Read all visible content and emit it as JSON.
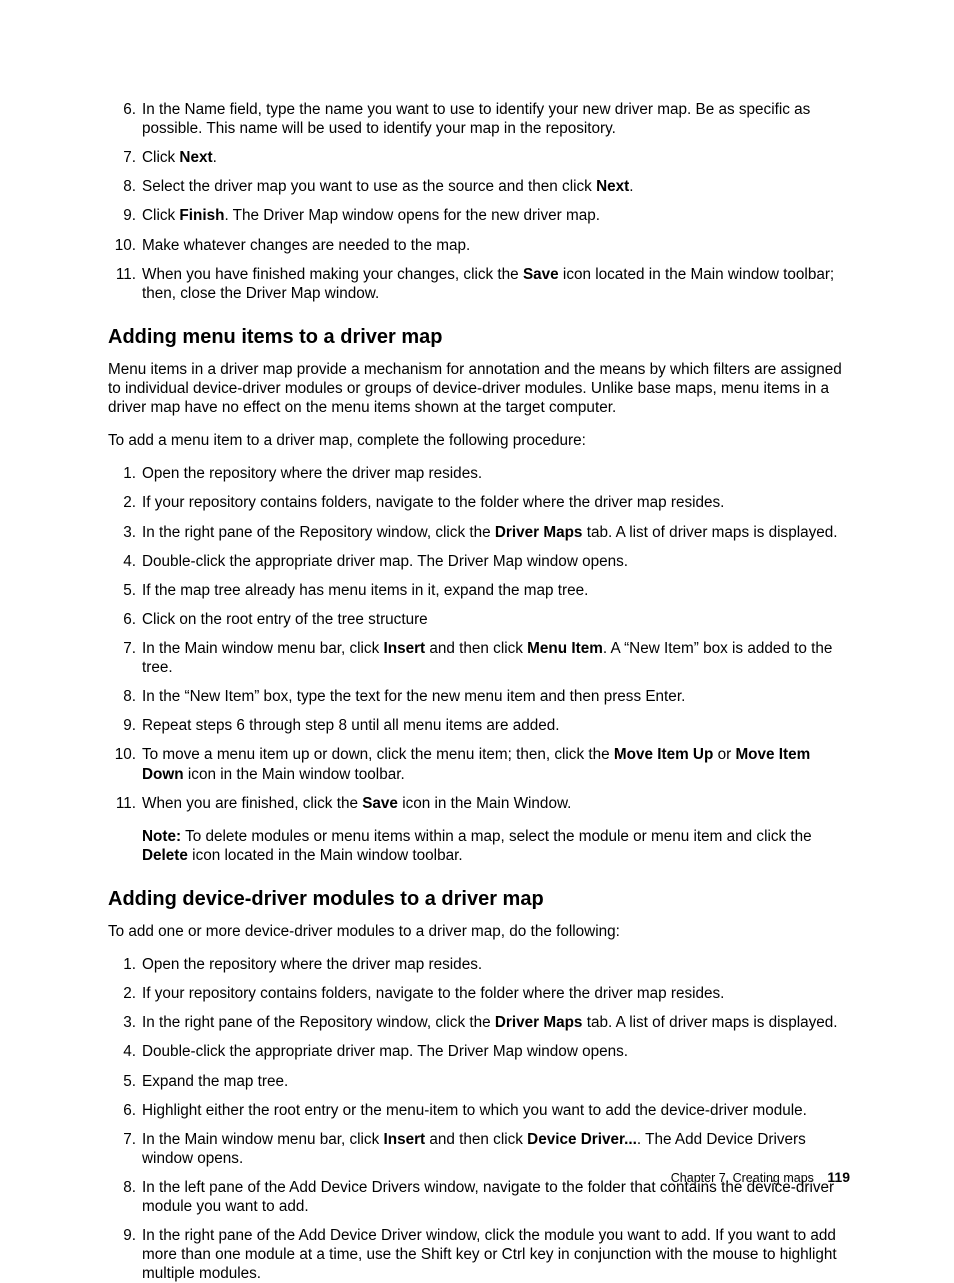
{
  "list1": [
    {
      "n": "6.",
      "html": "In the Name field, type the name you want to use to identify your new driver map. Be as specific as possible. This name will be used to identify your map in the repository."
    },
    {
      "n": "7.",
      "html": "Click <b>Next</b>."
    },
    {
      "n": "8.",
      "html": "Select the driver map you want to use as the source and then click <b>Next</b>."
    },
    {
      "n": "9.",
      "html": "Click <b>Finish</b>. The Driver Map window opens for the new driver map."
    },
    {
      "n": "10.",
      "html": "Make whatever changes are needed to the map."
    },
    {
      "n": "11.",
      "html": "When you have finished making your changes, click the <b>Save</b> icon located in the Main window toolbar; then, close the Driver Map window."
    }
  ],
  "sectionA": {
    "title": "Adding menu items to a driver map",
    "intro": "Menu items in a driver map provide a mechanism for annotation and the means by which filters are assigned to individual device-driver modules or groups of device-driver modules. Unlike base maps, menu items in a driver map have no effect on the menu items shown at the target computer.",
    "lead": "To add a menu item to a driver map, complete the following procedure:",
    "items": [
      {
        "n": "1.",
        "html": "Open the repository where the driver map resides."
      },
      {
        "n": "2.",
        "html": "If your repository contains folders, navigate to the folder where the driver map resides."
      },
      {
        "n": "3.",
        "html": "In the right pane of the Repository window, click the <b>Driver Maps</b> tab. A list of driver maps is displayed."
      },
      {
        "n": "4.",
        "html": "Double-click the appropriate driver map. The Driver Map window opens."
      },
      {
        "n": "5.",
        "html": "If the map tree already has menu items in it, expand the map tree."
      },
      {
        "n": "6.",
        "html": "Click on the root entry of the tree structure"
      },
      {
        "n": "7.",
        "html": "In the Main window menu bar, click <b>Insert</b> and then click <b>Menu Item</b>. A “New Item” box is added to the tree."
      },
      {
        "n": "8.",
        "html": "In the “New Item” box, type the text for the new menu item and then press Enter."
      },
      {
        "n": "9.",
        "html": "Repeat steps 6 through step 8 until all menu items are added."
      },
      {
        "n": "10.",
        "html": "To move a menu item up or down, click the menu item; then, click the <b>Move Item Up</b> or <b>Move Item Down</b> icon in the Main window toolbar."
      },
      {
        "n": "11.",
        "html": "When you are finished, click the <b>Save</b> icon in the Main Window.<div class=\"note-block\"><b>Note:</b> To delete modules or menu items within a map, select the module or menu item and click the <b>Delete</b> icon located in the Main window toolbar.</div>"
      }
    ]
  },
  "sectionB": {
    "title": "Adding device-driver modules to a driver map",
    "lead": "To add one or more device-driver modules to a driver map, do the following:",
    "items": [
      {
        "n": "1.",
        "html": "Open the repository where the driver map resides."
      },
      {
        "n": "2.",
        "html": "If your repository contains folders, navigate to the folder where the driver map resides."
      },
      {
        "n": "3.",
        "html": "In the right pane of the Repository window, click the <b>Driver Maps</b> tab. A list of driver maps is displayed."
      },
      {
        "n": "4.",
        "html": "Double-click the appropriate driver map. The Driver Map window opens."
      },
      {
        "n": "5.",
        "html": "Expand the map tree."
      },
      {
        "n": "6.",
        "html": "Highlight either the root entry or the menu-item to which you want to add the device-driver module."
      },
      {
        "n": "7.",
        "html": "In the Main window menu bar, click <b>Insert</b> and then click <b>Device Driver...</b>. The Add Device Drivers window opens."
      },
      {
        "n": "8.",
        "html": "In the left pane of the Add Device Drivers window, navigate to the folder that contains the device-driver module you want to add."
      },
      {
        "n": "9.",
        "html": "In the right pane of the Add Device Driver window, click the module you want to add. If you want to add more than one module at a time, use the Shift key or Ctrl key in conjunction with the mouse to highlight multiple modules."
      }
    ]
  },
  "footer": {
    "chapter": "Chapter 7. Creating maps",
    "page": "119"
  }
}
